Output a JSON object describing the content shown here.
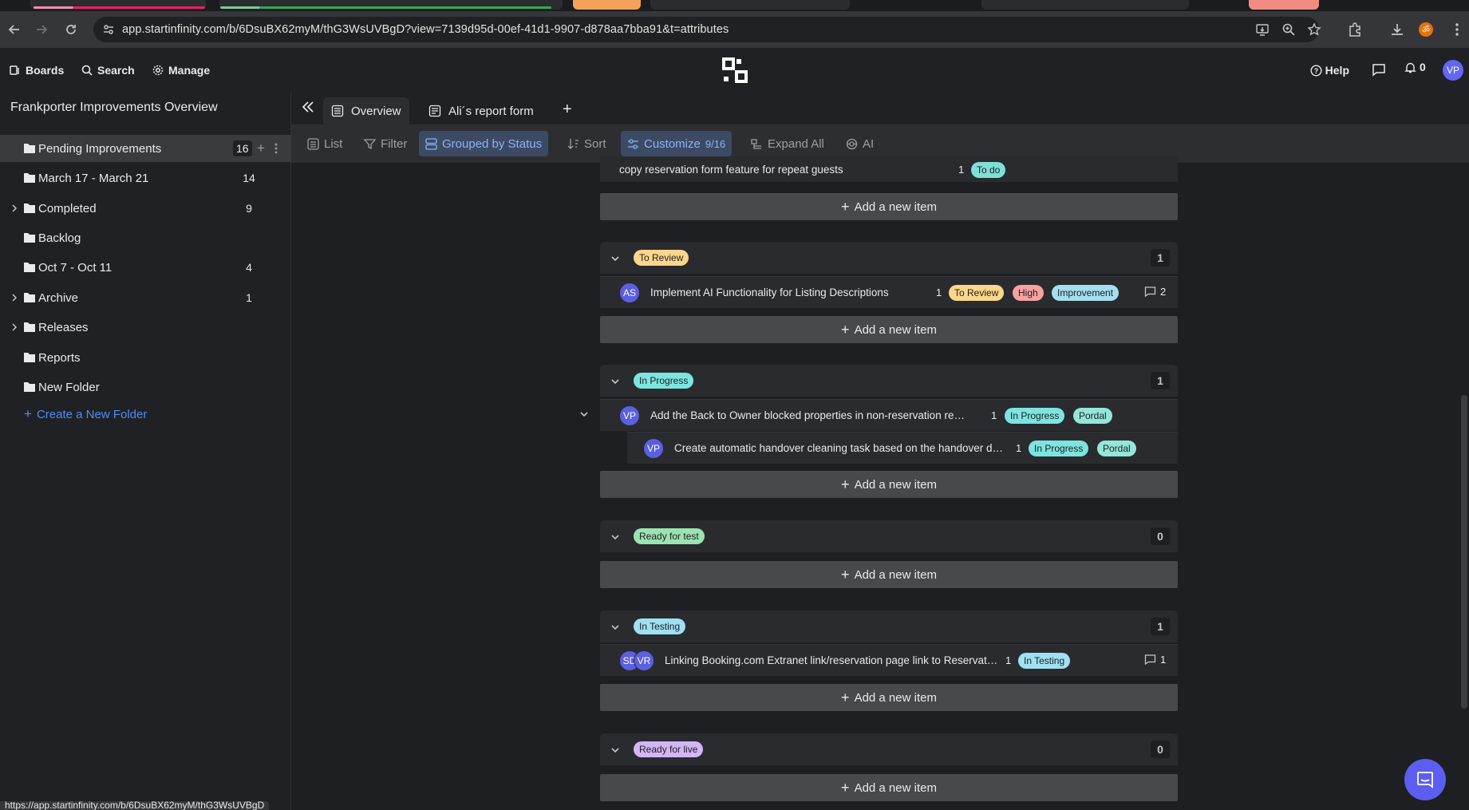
{
  "browser": {
    "url": "app.startinfinity.com/b/6DsuBX62myM/thG3WsUVBgD?view=7139d95d-00ef-41d1-9907-d878aa7bba91&t=attributes",
    "status_url": "https://app.startinfinity.com/b/6DsuBX62myM/thG3WsUVBgD"
  },
  "header": {
    "boards_label": "Boards",
    "search_label": "Search",
    "manage_label": "Manage",
    "help_label": "Help",
    "notification_count": "0",
    "user_initials": "VP"
  },
  "sidebar": {
    "board_title": "Frankporter Improvements Overview",
    "folders": [
      {
        "label": "Pending Improvements",
        "count": "16",
        "expandable": false
      },
      {
        "label": "March 17 - March 21",
        "count": "14",
        "expandable": false
      },
      {
        "label": "Completed",
        "count": "9",
        "expandable": true
      },
      {
        "label": "Backlog",
        "count": "",
        "expandable": false
      },
      {
        "label": "Oct 7 - Oct 11",
        "count": "4",
        "expandable": false
      },
      {
        "label": "Archive",
        "count": "1",
        "expandable": true
      },
      {
        "label": "Releases",
        "count": "",
        "expandable": true
      },
      {
        "label": "Reports",
        "count": "",
        "expandable": false
      },
      {
        "label": "New Folder",
        "count": "",
        "expandable": false
      }
    ],
    "create_folder_label": "Create a New Folder"
  },
  "views": {
    "tabs": [
      {
        "label": "Overview"
      },
      {
        "label": "Ali´s report form"
      }
    ]
  },
  "toolbar": {
    "list": "List",
    "filter": "Filter",
    "grouped": "Grouped by Status",
    "sort": "Sort",
    "customize": "Customize",
    "customize_count": "9/16",
    "expand_all": "Expand All",
    "ai": "AI"
  },
  "content": {
    "add_item_label": "Add a new item",
    "partial_row": {
      "title": "copy reservation form feature for repeat guests",
      "num": "1",
      "tag": "To do"
    },
    "groups": [
      {
        "status": "To Review",
        "count": "1",
        "rows": [
          {
            "initials": "AS",
            "title": "Implement AI Functionality for Listing Descriptions",
            "num": "1",
            "tags": [
              "To Review",
              "High",
              "Improvement"
            ],
            "comments": "2"
          }
        ]
      },
      {
        "status": "In Progress",
        "count": "1",
        "rows": [
          {
            "initials": "VP",
            "title": "Add the Back to Owner blocked properties in non-reservation report",
            "num": "1",
            "tags": [
              "In Progress",
              "Pordal"
            ]
          },
          {
            "initials": "VP",
            "title": "Create automatic handover cleaning task based on the handover dat...",
            "num": "1",
            "tags": [
              "In Progress",
              "Pordal"
            ]
          }
        ]
      },
      {
        "status": "Ready for test",
        "count": "0",
        "rows": []
      },
      {
        "status": "In Testing",
        "count": "1",
        "rows": [
          {
            "initials": [
              "SD",
              "VR"
            ],
            "title": "Linking Booking.com Extranet link/reservation page link to Reservatio...",
            "num": "1",
            "tags": [
              "In Testing"
            ],
            "comments": "1"
          }
        ]
      },
      {
        "status": "Ready for live",
        "count": "0",
        "rows": []
      }
    ]
  },
  "colors": {
    "to_do": "#7ee0d6",
    "to_review": "#fcd68a",
    "in_progress": "#7de5df",
    "ready_for_test": "#9be3b0",
    "in_testing": "#9fe0f2",
    "ready_for_live": "#d4b5f5",
    "high": "#f7a1a1",
    "improvement": "#a3dff0",
    "pordal": "#93e6d9",
    "accent": "#8ab4f8"
  }
}
